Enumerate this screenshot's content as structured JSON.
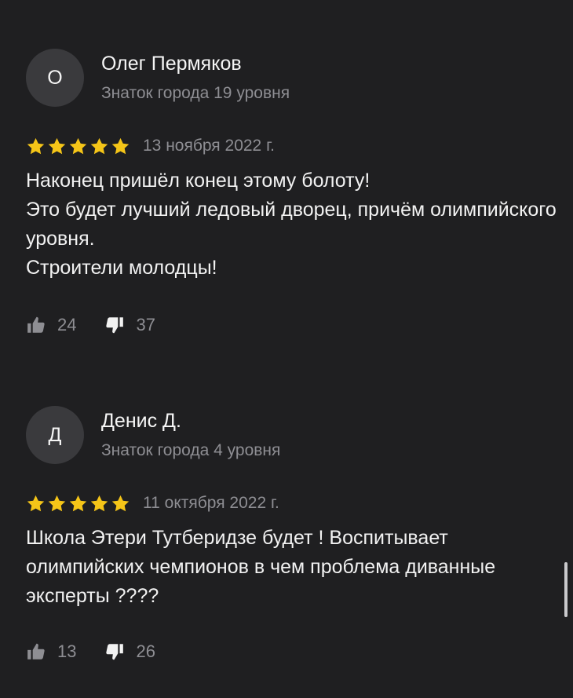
{
  "colors": {
    "background": "#1f1f21",
    "star": "#f5c518",
    "secondary_text": "#8e8e93",
    "avatar_bg": "#3a3a3d"
  },
  "reviews": [
    {
      "avatar_letter": "О",
      "author_name": "Олег Пермяков",
      "author_level": "Знаток города 19 уровня",
      "rating": 5,
      "date": "13 ноября 2022 г.",
      "text": "Наконец пришёл конец этому болоту!\nЭто будет лучший ледовый дворец, причём олимпийского уровня.\nСтроители молодцы!",
      "likes": "24",
      "dislikes": "37"
    },
    {
      "avatar_letter": "Д",
      "author_name": "Денис Д.",
      "author_level": "Знаток города 4 уровня",
      "rating": 5,
      "date": "11 октября 2022 г.",
      "text": "Школа Этери Тутберидзе будет ! Воспитывает олимпийских чемпионов в чем проблема диванные эксперты ????",
      "likes": "13",
      "dislikes": "26"
    }
  ],
  "icons": {
    "like": "thumbs-up-icon",
    "dislike": "thumbs-down-icon",
    "star": "star-icon"
  }
}
